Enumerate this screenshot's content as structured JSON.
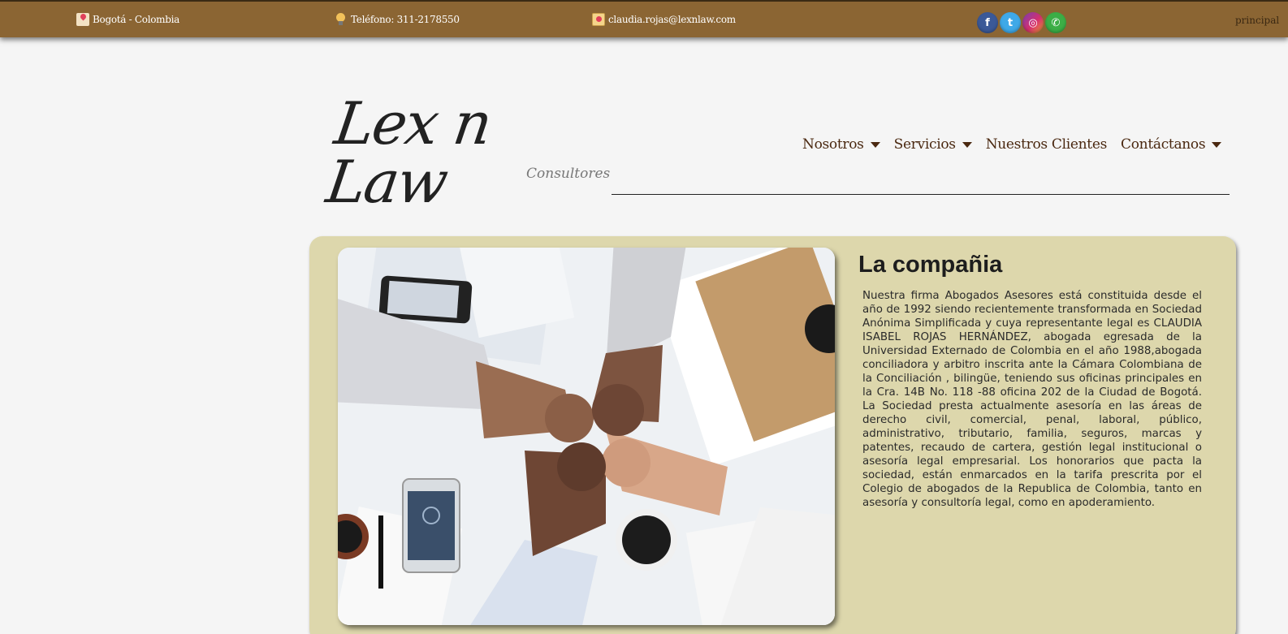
{
  "topbar": {
    "location": "Bogotá - Colombia",
    "phone": "Teléfono: 311-2178550",
    "email": "claudia.rojas@lexnlaw.com",
    "social": [
      {
        "name": "facebook",
        "glyph": "f",
        "color": "#3b5998"
      },
      {
        "name": "twitter",
        "glyph": "t",
        "color": "#3fa9e8"
      },
      {
        "name": "instagram",
        "glyph": "◎",
        "color": "#d52f6e"
      },
      {
        "name": "whatsapp",
        "glyph": "✆",
        "color": "#3cae46"
      }
    ],
    "principal_link": "principal"
  },
  "logo": {
    "main": "Lex n Law",
    "sub": "Consultores"
  },
  "nav": {
    "items": [
      {
        "label": "Nosotros",
        "dropdown": true
      },
      {
        "label": "Servicios",
        "dropdown": true
      },
      {
        "label": "Nuestros Clientes",
        "dropdown": false
      },
      {
        "label": "Contáctanos",
        "dropdown": true
      }
    ]
  },
  "section": {
    "title": "La compañia",
    "body": "Nuestra firma Abogados Asesores está constituida desde el año de 1992 siendo recientemente transformada en Sociedad Anónima Simplificada y cuya representante legal es CLAUDIA ISABEL ROJAS HERNÁNDEZ, abogada egresada de la Universidad Externado de Colombia en el año 1988,abogada conciliadora y arbitro inscrita ante la Cámara Colombiana de la Conciliación , bilingüe, teniendo sus oficinas principales en la Cra. 14B No. 118 -88 oficina 202 de la Ciudad de Bogotá. La Sociedad presta actualmente asesoría en las áreas de derecho civil, comercial, penal, laboral, público, administrativo, tributario, familia, seguros, marcas y patentes, recaudo de cartera, gestión legal institucional o asesoría legal empresarial. Los honorarios que pacta la sociedad, están enmarcados en la tarifa prescrita por el Colegio de abogados de la Republica de Colombia, tanto en asesoría y consultoría legal, como en apoderamiento."
  },
  "colors": {
    "topbar": "#8b6533",
    "card": "#ddd7ac",
    "nav_text": "#4a2810"
  }
}
